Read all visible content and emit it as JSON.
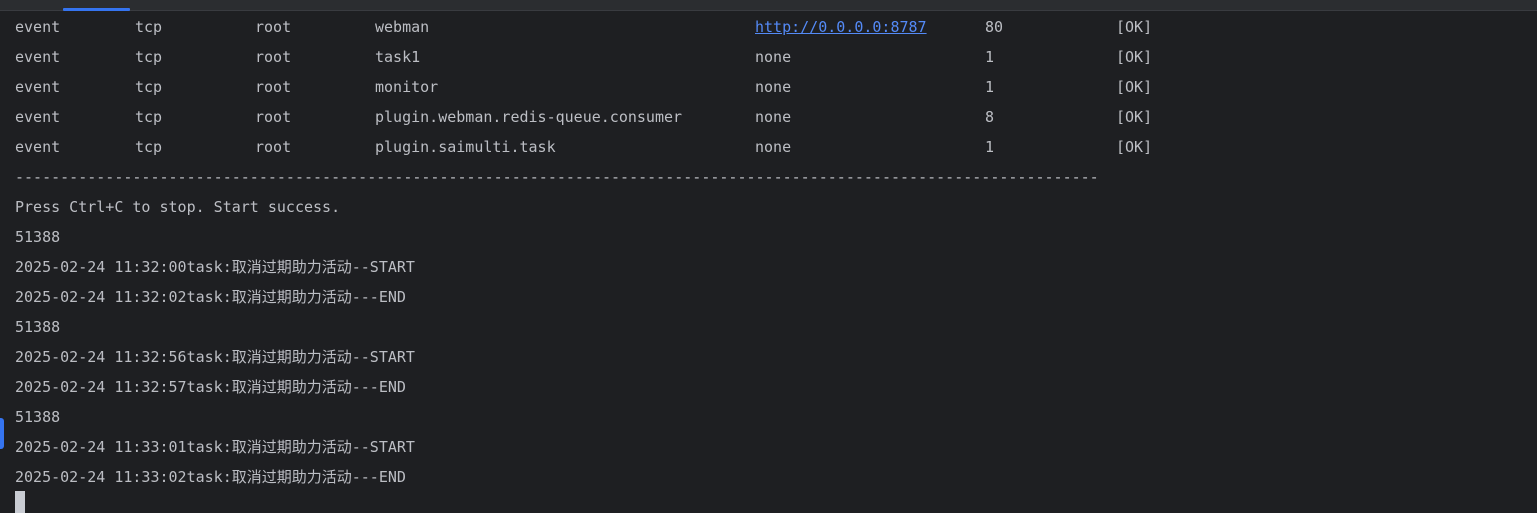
{
  "process_table": {
    "rows": [
      {
        "user": "event",
        "transport": "tcp",
        "group": "root",
        "name": "webman",
        "listen": "http://0.0.0.0:8787",
        "count": "80",
        "status": "[OK]"
      },
      {
        "user": "event",
        "transport": "tcp",
        "group": "root",
        "name": "task1",
        "listen": "none",
        "count": "1",
        "status": "[OK]"
      },
      {
        "user": "event",
        "transport": "tcp",
        "group": "root",
        "name": "monitor",
        "listen": "none",
        "count": "1",
        "status": "[OK]"
      },
      {
        "user": "event",
        "transport": "tcp",
        "group": "root",
        "name": "plugin.webman.redis-queue.consumer",
        "listen": "none",
        "count": "8",
        "status": "[OK]"
      },
      {
        "user": "event",
        "transport": "tcp",
        "group": "root",
        "name": "plugin.saimulti.task",
        "listen": "none",
        "count": "1",
        "status": "[OK]"
      }
    ],
    "separator": "------------------------------------------------------------------------------------------------------------------------"
  },
  "log_lines": [
    "Press Ctrl+C to stop. Start success.",
    "51388",
    "2025-02-24 11:32:00task:取消过期助力活动--START",
    "2025-02-24 11:32:02task:取消过期助力活动---END",
    "51388",
    "2025-02-24 11:32:56task:取消过期助力活动--START",
    "2025-02-24 11:32:57task:取消过期助力活动---END",
    "51388",
    "2025-02-24 11:33:01task:取消过期助力活动--START",
    "2025-02-24 11:33:02task:取消过期助力活动---END"
  ],
  "colors": {
    "background": "#1e1f22",
    "text": "#bcbec4",
    "link": "#548af7",
    "accent": "#3574f0"
  }
}
